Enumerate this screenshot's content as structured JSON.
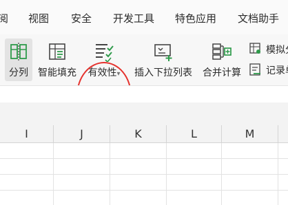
{
  "menubar": {
    "items": [
      "阅",
      "视图",
      "安全",
      "开发工具",
      "特色应用",
      "文档助手"
    ]
  },
  "ribbon": {
    "tools": [
      {
        "label": "分列",
        "icon": "split-columns-icon"
      },
      {
        "label": "智能填充",
        "icon": "smart-fill-icon"
      },
      {
        "label": "有效性",
        "icon": "validation-icon",
        "dropdown": "▾"
      },
      {
        "label": "插入下拉列表",
        "icon": "insert-dropdown-list-icon"
      },
      {
        "label": "合并计算",
        "icon": "consolidate-icon"
      }
    ],
    "small_tools": [
      {
        "label": "模拟分",
        "icon": "simulate-analysis-icon"
      },
      {
        "label": "记录单",
        "icon": "record-form-icon"
      }
    ]
  },
  "grid": {
    "columns": [
      "I",
      "J",
      "K",
      "L",
      "M"
    ]
  },
  "colors": {
    "highlight": "#e5322d",
    "icon_green": "#2e9a4a",
    "icon_dark": "#444444"
  }
}
